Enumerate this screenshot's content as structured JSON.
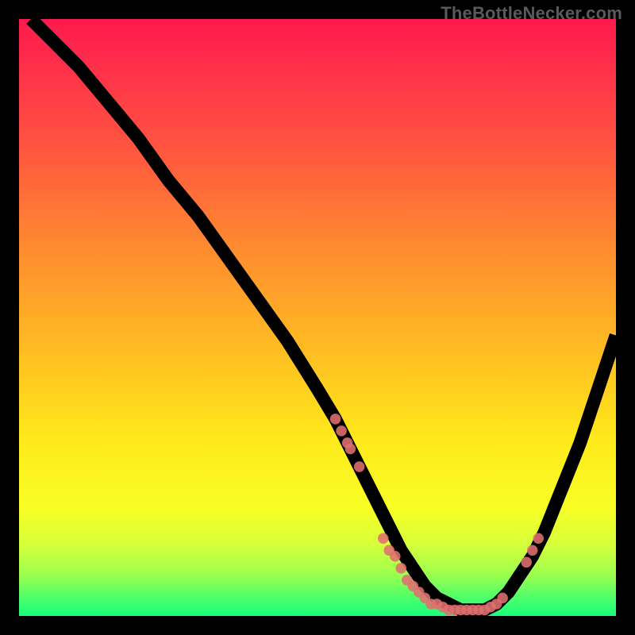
{
  "watermark": "TheBottleNecker.com",
  "colors": {
    "dot": "#e07070",
    "curve": "#000000"
  },
  "chart_data": {
    "type": "line",
    "title": "",
    "xlabel": "",
    "ylabel": "",
    "xlim": [
      0,
      100
    ],
    "ylim": [
      0,
      100
    ],
    "grid": false,
    "series": [
      {
        "name": "bottleneck-curve",
        "x": [
          2,
          5,
          10,
          15,
          20,
          25,
          30,
          35,
          40,
          45,
          50,
          53,
          56,
          58,
          60,
          62,
          64,
          66,
          68,
          70,
          72,
          74,
          76,
          78,
          80,
          82,
          84,
          86,
          88,
          90,
          92,
          94,
          96,
          98,
          100
        ],
        "y": [
          100,
          97,
          92,
          86,
          80,
          73,
          67,
          60,
          53,
          46,
          38,
          33,
          27,
          23,
          19,
          15,
          11,
          8,
          5,
          3,
          2,
          1,
          1,
          1,
          2,
          4,
          7,
          10,
          14,
          19,
          24,
          29,
          35,
          41,
          47
        ]
      }
    ],
    "scatter": [
      {
        "name": "highlighted-points",
        "x": [
          53,
          54,
          55,
          55.5,
          57,
          61,
          62,
          63,
          64,
          65,
          66,
          67,
          68,
          69,
          70,
          71,
          72,
          73,
          74,
          75,
          76,
          77,
          78,
          79,
          80,
          81,
          85,
          86,
          87
        ],
        "y": [
          33,
          31,
          29,
          28,
          25,
          13,
          11,
          10,
          8,
          6,
          5,
          4,
          3,
          2,
          2,
          1.5,
          1,
          1,
          1,
          1,
          1,
          1,
          1,
          1.5,
          2,
          3,
          9,
          11,
          13
        ]
      }
    ]
  }
}
